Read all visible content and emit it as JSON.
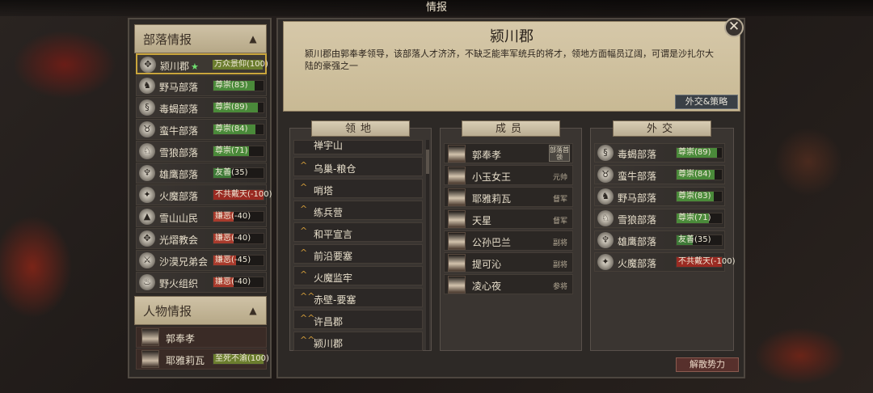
{
  "window_title": "情报",
  "left": {
    "tribe_header": "部落情报",
    "person_header": "人物情报",
    "tribes": [
      {
        "icon": "cross-totem-icon",
        "glyph": "✥",
        "name": "颍川郡",
        "star": "★",
        "badge": "万众景仰(100)",
        "badge_color": "#6b7d2e",
        "level": 1.0,
        "selected": true
      },
      {
        "icon": "horse-head-icon",
        "glyph": "♞",
        "name": "野马部落",
        "badge": "尊崇(83)",
        "badge_color": "#4a8a3a",
        "level": 0.83
      },
      {
        "icon": "scorpion-icon",
        "glyph": "§",
        "name": "毒蝎部落",
        "badge": "尊崇(89)",
        "badge_color": "#4a8a3a",
        "level": 0.89
      },
      {
        "icon": "ox-head-icon",
        "glyph": "♉",
        "name": "蛮牛部落",
        "badge": "尊崇(84)",
        "badge_color": "#4a8a3a",
        "level": 0.84
      },
      {
        "icon": "wolf-head-icon",
        "glyph": "♘",
        "name": "雪狼部落",
        "badge": "尊崇(71)",
        "badge_color": "#4a8a3a",
        "level": 0.71
      },
      {
        "icon": "eagle-icon",
        "glyph": "♆",
        "name": "雄鹰部落",
        "badge": "友善(35)",
        "badge_color": "#3e7a38",
        "level": 0.35
      },
      {
        "icon": "fire-demon-icon",
        "glyph": "✦",
        "name": "火魔部落",
        "badge": "不共戴天(-100)",
        "badge_color": "#9a2a22",
        "level": 1.0
      },
      {
        "icon": "mountain-icon",
        "glyph": "▲",
        "name": "雪山山民",
        "badge": "嫌恶(-40)",
        "badge_color": "#a83a2c",
        "level": 0.4
      },
      {
        "icon": "light-church-icon",
        "glyph": "✥",
        "name": "光熠教会",
        "badge": "嫌恶(-40)",
        "badge_color": "#a83a2c",
        "level": 0.4
      },
      {
        "icon": "crossed-swords-icon",
        "glyph": "⚔",
        "name": "沙漠兄弟会",
        "badge": "嫌恶(-45)",
        "badge_color": "#a83a2c",
        "level": 0.45
      },
      {
        "icon": "flame-icon",
        "glyph": "♨",
        "name": "野火组织",
        "badge": "嫌恶(-40)",
        "badge_color": "#a83a2c",
        "level": 0.4
      }
    ],
    "persons": [
      {
        "name": "郭奉孝",
        "badge": ""
      },
      {
        "name": "耶雅莉瓦",
        "badge": "至死不渝(100)",
        "badge_color": "#6b7d2e",
        "level": 1.0
      }
    ]
  },
  "info": {
    "title": "颍川郡",
    "description": "颍川郡由郭奉孝领导，该部落人才济济，不缺乏能率军统兵的将才，领地方面幅员辽阔，可谓是沙扎尔大陆的豪强之一",
    "diplomacy_button": "外交&策略"
  },
  "territory": {
    "header": "领地",
    "items": [
      {
        "name": "禅宇山",
        "chevron": "^"
      },
      {
        "name": "乌巢-粮仓",
        "chevron": "^"
      },
      {
        "name": "哨塔",
        "chevron": "^"
      },
      {
        "name": "练兵营",
        "chevron": "^"
      },
      {
        "name": "和平宣言",
        "chevron": "^"
      },
      {
        "name": "前沿要塞",
        "chevron": "^"
      },
      {
        "name": "火魔监牢",
        "chevron": "^"
      },
      {
        "name": "赤壁-要塞",
        "chevron": "^^"
      },
      {
        "name": "许昌郡",
        "chevron": "^^"
      },
      {
        "name": "颍川郡",
        "chevron": "^^"
      }
    ]
  },
  "members": {
    "header": "成员",
    "items": [
      {
        "name": "郭奉孝",
        "role": "",
        "leader_tag": "部落首领"
      },
      {
        "name": "小玉女王",
        "role": "元帅"
      },
      {
        "name": "耶雅莉瓦",
        "role": "督军"
      },
      {
        "name": "天星",
        "role": "督军"
      },
      {
        "name": "公孙巴兰",
        "role": "副将"
      },
      {
        "name": "提可沁",
        "role": "副将"
      },
      {
        "name": "凌心夜",
        "role": "参将"
      }
    ]
  },
  "diplomacy": {
    "header": "外交",
    "items": [
      {
        "icon": "scorpion-icon",
        "glyph": "§",
        "name": "毒蝎部落",
        "badge": "尊崇(89)",
        "badge_color": "#4a8a3a",
        "level": 0.89
      },
      {
        "icon": "ox-head-icon",
        "glyph": "♉",
        "name": "蛮牛部落",
        "badge": "尊崇(84)",
        "badge_color": "#4a8a3a",
        "level": 0.84
      },
      {
        "icon": "horse-head-icon",
        "glyph": "♞",
        "name": "野马部落",
        "badge": "尊崇(83)",
        "badge_color": "#4a8a3a",
        "level": 0.83
      },
      {
        "icon": "wolf-head-icon",
        "glyph": "♘",
        "name": "雪狼部落",
        "badge": "尊崇(71)",
        "badge_color": "#4a8a3a",
        "level": 0.71
      },
      {
        "icon": "eagle-icon",
        "glyph": "♆",
        "name": "雄鹰部落",
        "badge": "友善(35)",
        "badge_color": "#3e7a38",
        "level": 0.35
      },
      {
        "icon": "fire-demon-icon",
        "glyph": "✦",
        "name": "火魔部落",
        "badge": "不共戴天(-100)",
        "badge_color": "#9a2a22",
        "level": 1.0
      }
    ]
  },
  "dissolve_button": "解散势力",
  "close_glyph": "✕"
}
